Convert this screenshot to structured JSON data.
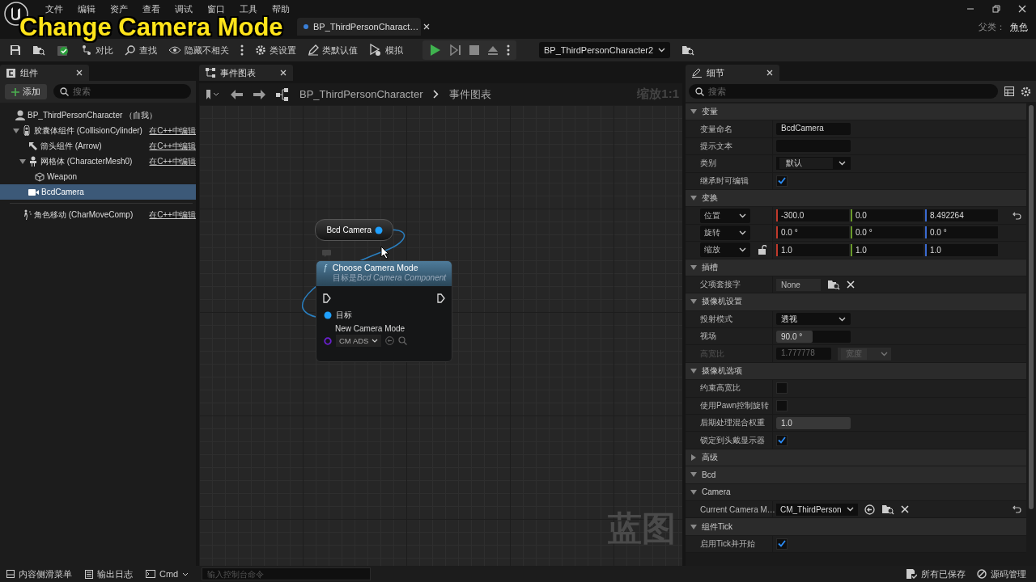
{
  "caption": "Change Camera Mode",
  "menu": [
    "文件",
    "编辑",
    "资产",
    "查看",
    "调试",
    "窗口",
    "工具",
    "帮助"
  ],
  "document_tabs": [
    {
      "label": "BP_ThirdPersonCharact…",
      "selected": true
    }
  ],
  "parent_class": {
    "label": "父类：",
    "value": "角色"
  },
  "toolbar": [
    {
      "kind": "save"
    },
    {
      "kind": "browse"
    },
    {
      "kind": "compile"
    },
    {
      "kind": "diff",
      "label": "对比"
    },
    {
      "kind": "find",
      "label": "查找"
    },
    {
      "kind": "hide",
      "label": "隐藏不相关"
    },
    {
      "kind": "more"
    },
    {
      "kind": "class-settings",
      "label": "类设置"
    },
    {
      "kind": "class-defaults",
      "label": "类默认值"
    },
    {
      "kind": "simulate",
      "label": "模拟"
    }
  ],
  "debug_object": "BP_ThirdPersonCharacter2",
  "components": {
    "title": "组件",
    "add_label": "添加",
    "search_placeholder": "搜索",
    "tree": [
      {
        "kind": "actor",
        "label": "BP_ThirdPersonCharacter （自我）",
        "selected": false,
        "children": [
          {
            "kind": "capsule",
            "label": "胶囊体组件 (CollisionCylinder)",
            "link": "在C++中编辑",
            "selected": false,
            "expanded": true,
            "children": [
              {
                "kind": "arrow",
                "label": "箭头组件 (Arrow)",
                "link": "在C++中编辑",
                "selected": false
              },
              {
                "kind": "mesh",
                "label": "网格体 (CharacterMesh0)",
                "link": "在C++中编辑",
                "selected": false,
                "expanded": true,
                "children": [
                  {
                    "kind": "static-mesh",
                    "label": "Weapon",
                    "selected": false
                  }
                ]
              },
              {
                "kind": "camera",
                "label": "BcdCamera",
                "selected": true
              }
            ]
          }
        ]
      }
    ],
    "extra": [
      {
        "kind": "movement",
        "label": "角色移动 (CharMoveComp)",
        "link": "在C++中编辑",
        "selected": false
      }
    ]
  },
  "graph": {
    "tab": "事件图表",
    "breadcrumb": [
      "BP_ThirdPersonCharacter",
      "事件图表"
    ],
    "zoom": "缩放1:1",
    "watermark": "蓝图",
    "variable_node": {
      "label": "Bcd Camera"
    },
    "function_node": {
      "symbol": "ƒ",
      "title": "Choose Camera Mode",
      "subtitle": {
        "prefix": "目标是",
        "target": "Bcd Camera Component"
      },
      "pins": [
        {
          "kind": "object",
          "label": "目标"
        },
        {
          "kind": "enum",
          "label": "New Camera Mode",
          "value": "CM ADS"
        }
      ]
    }
  },
  "details": {
    "title": "细节",
    "search_placeholder": "搜索",
    "sections": [
      {
        "title": "变量",
        "expanded": true,
        "rows": [
          {
            "kind": "text",
            "label": "变量命名",
            "value": "BcdCamera"
          },
          {
            "kind": "text",
            "label": "提示文本"
          },
          {
            "kind": "combo",
            "label": "类别",
            "value": "默认"
          },
          {
            "kind": "checkbox",
            "label": "继承时可编辑",
            "checked": true
          }
        ]
      },
      {
        "title": "变换",
        "expanded": true,
        "rows": [
          {
            "kind": "vector",
            "label": "位置",
            "values": [
              "-300.0",
              "0.0",
              "8.492264"
            ],
            "reset": true
          },
          {
            "kind": "vector",
            "label": "旋转",
            "values": [
              "0.0 °",
              "0.0 °",
              "0.0 °"
            ]
          },
          {
            "kind": "vector",
            "label": "缩放",
            "values": [
              "1.0",
              "1.0",
              "1.0"
            ],
            "locked": false
          }
        ]
      },
      {
        "title": "插槽",
        "expanded": true,
        "rows": [
          {
            "kind": "socket",
            "label": "父项套接字",
            "value": "None"
          }
        ]
      },
      {
        "title": "摄像机设置",
        "expanded": true,
        "rows": [
          {
            "kind": "dropdown",
            "label": "投射模式",
            "value": "透视"
          },
          {
            "kind": "number",
            "label": "视场",
            "value": "90.0 °",
            "level": 0.49
          },
          {
            "kind": "aspect",
            "label": "高宽比",
            "value": "1.777778",
            "option": "宽度",
            "disabled": true
          }
        ]
      },
      {
        "title": "摄像机选项",
        "expanded": true,
        "rows": [
          {
            "kind": "checkbox",
            "label": "约束高宽比",
            "checked": false
          },
          {
            "kind": "checkbox",
            "label": "使用Pawn控制旋转",
            "checked": false
          },
          {
            "kind": "number",
            "label": "后期处理混合权重",
            "value": "1.0",
            "level": 1
          },
          {
            "kind": "checkbox",
            "label": "锁定到头戴显示器",
            "checked": true
          }
        ]
      },
      {
        "title": "高级",
        "expanded": false
      },
      {
        "title": "Bcd",
        "expanded": true,
        "subsections": [
          {
            "title": "Camera",
            "expanded": true,
            "rows": [
              {
                "kind": "asset",
                "label": "Current Camera M…",
                "value": "CM_ThirdPerson",
                "reset": true
              }
            ]
          }
        ]
      },
      {
        "title": "组件Tick",
        "expanded": true,
        "rows": [
          {
            "kind": "checkbox",
            "label": "启用Tick并开始",
            "checked": true
          }
        ]
      }
    ]
  },
  "status_bar": {
    "items": [
      {
        "kind": "drawer",
        "label": "内容侧滑菜单"
      },
      {
        "kind": "log",
        "label": "输出日志"
      },
      {
        "kind": "cmd",
        "label": "Cmd"
      }
    ],
    "console_placeholder": "输入控制台命令",
    "right": [
      {
        "kind": "saved",
        "label": "所有已保存"
      },
      {
        "kind": "source",
        "label": "源码管理"
      }
    ]
  }
}
